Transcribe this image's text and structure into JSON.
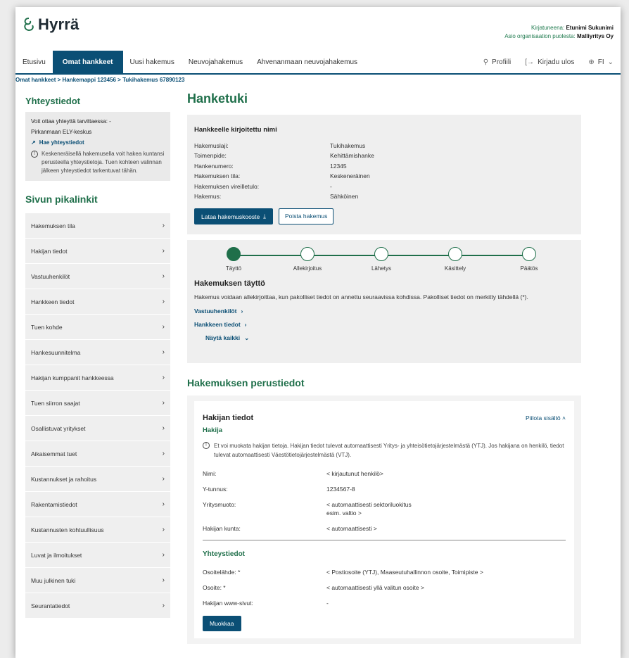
{
  "header": {
    "logo_text": "Hyrrä",
    "logged_in_label": "Kirjatuneena:",
    "logged_in_value": "Etunimi Sukunimi",
    "org_label": "Asio organisaation puolesta:",
    "org_value": "Malliyritys Oy"
  },
  "nav": {
    "tabs": [
      "Etusivu",
      "Omat hankkeet",
      "Uusi hakemus",
      "Neuvojahakemus",
      "Ahvenanmaan neuvojahakemus"
    ],
    "active_index": 1,
    "profile": "Profiili",
    "logout": "Kirjadu ulos",
    "language": "FI"
  },
  "breadcrumb": "Omat hankkeet > Hankemappi 123456 > Tukihakemus 67890123",
  "sidebar": {
    "contact_title": "Yhteystiedot",
    "contact_reach": "Voit ottaa yhteyttä tarvittaessa: -",
    "contact_org": "Pirkanmaan ELY-keskus",
    "contact_link": "Hae yhteystiedot",
    "contact_info": "Keskeneräisellä hakemusella voit hakea kuntansi perusteella yhteystietoja. Tuen kohteen valinnan jälkeen yhteystiedot tarkentuvat tähän.",
    "quick_title": "Sivun pikalinkit",
    "quick_links": [
      "Hakemuksen tila",
      "Hakijan tiedot",
      "Vastuuhenkilöt",
      "Hankkeen tiedot",
      "Tuen kohde",
      "Hankesuunnitelma",
      "Hakijan kumppanit hankkeessa",
      "Tuen siirron saajat",
      "Osallistuvat yritykset",
      "Aikaisemmat tuet",
      "Kustannukset ja rahoitus",
      "Rakentamistiedot",
      "Kustannusten kohtuullisuus",
      "Luvat ja ilmoitukset",
      "Muu julkinen tuki",
      "Seurantatiedot"
    ]
  },
  "main": {
    "title": "Hanketuki",
    "summary": {
      "title": "Hankkeelle kirjoitettu nimi",
      "rows": [
        {
          "k": "Hakemuslaji:",
          "v": "Tukihakemus"
        },
        {
          "k": "Toimenpide:",
          "v": "Kehittämishanke"
        },
        {
          "k": "Hankenumero:",
          "v": "12345"
        },
        {
          "k": "Hakemuksen tila:",
          "v": "Keskeneräinen"
        },
        {
          "k": "Hakemuksen vireilletulo:",
          "v": "-"
        },
        {
          "k": "Hakemus:",
          "v": "Sähköinen"
        }
      ],
      "download_btn": "Lataa hakemuskooste",
      "delete_btn": "Poista hakemus"
    },
    "progress": {
      "steps": [
        "Täyttö",
        "Allekirjoitus",
        "Lähetys",
        "Käsittely",
        "Päätös"
      ],
      "current_step": 1,
      "title": "Hakemuksen täyttö",
      "text": "Hakemus voidaan allekirjoittaa, kun pakolliset tiedot on annettu seuraavissa kohdissa. Pakolliset tiedot on merkitty tähdellä (*).",
      "links": [
        "Vastuuhenkilöt",
        "Hankkeen tiedot"
      ],
      "show_all": "Näytä kaikki"
    },
    "basic_title": "Hakemuksen perustiedot",
    "applicant": {
      "title": "Hakijan tiedot",
      "hide": "Piilota sisältö",
      "subtitle": "Hakija",
      "note": "Et voi muokata hakijan tietoja. Hakijan tiedot tulevat automaattisesti Yritys- ja yhteisötietojärjestelmästä (YTJ). Jos hakijana on henkilö, tiedot tulevat automaattisesti Väestötietojärjestelmästä (VTJ).",
      "rows": [
        {
          "k": "Nimi:",
          "v": "< kirjautunut henkilö>"
        },
        {
          "k": "Y-tunnus:",
          "v": "1234567-8"
        },
        {
          "k": "Yritysmuoto:",
          "v": "< automaattisesti sektoriluokitus",
          "v2": "esim. valtio >"
        },
        {
          "k": "Hakijan kunta:",
          "v": "< automaattisesti >"
        }
      ],
      "contact_title": "Yhteystiedot",
      "contact_rows": [
        {
          "k": "Osoitelähde: *",
          "v": "< Postiosoite (YTJ), Maaseutuhallinnon osoite, Toimipiste >"
        },
        {
          "k": "Osoite: *",
          "v": "< automaattisesti yllä valitun osoite >"
        },
        {
          "k": "Hakijan www-sivut:",
          "v": "-"
        }
      ],
      "edit_btn": "Muokkaa"
    }
  }
}
